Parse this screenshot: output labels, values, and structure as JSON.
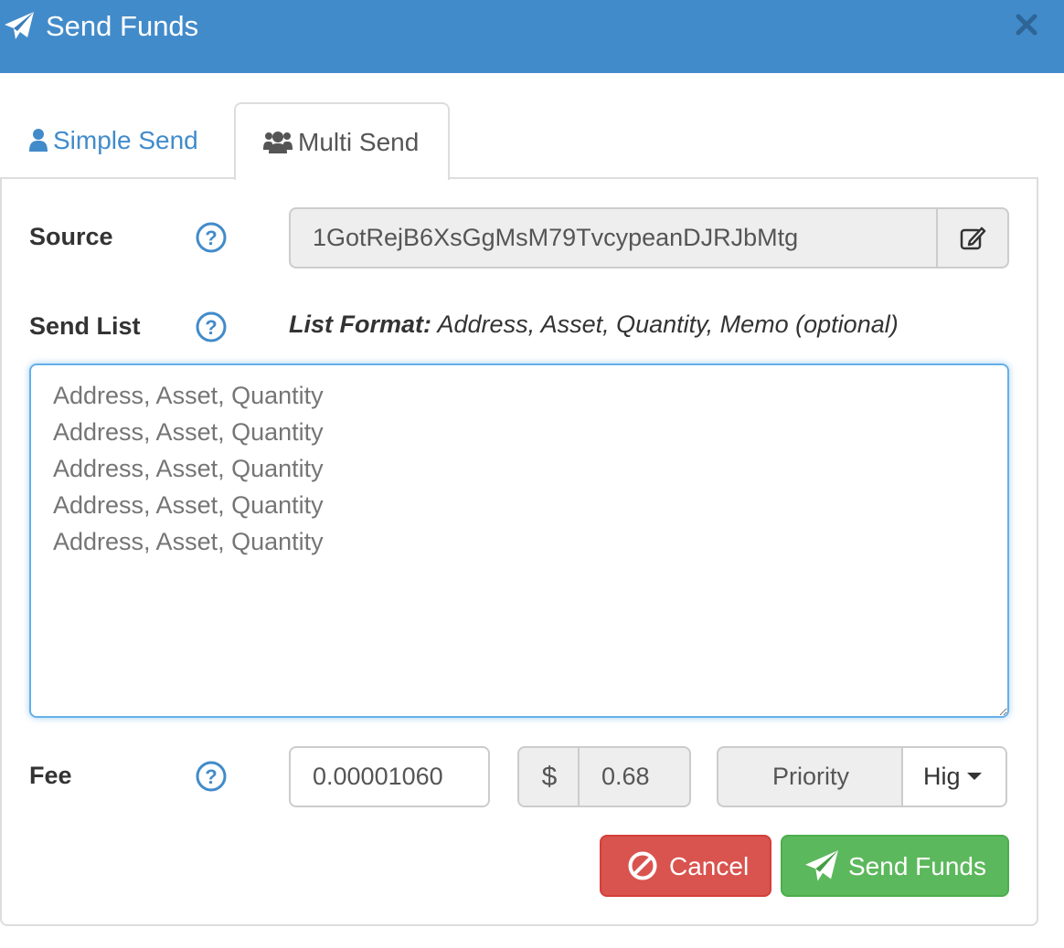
{
  "header": {
    "title": "Send Funds",
    "icon": "paper-plane-icon",
    "close_icon": "close-icon",
    "color": "#428bca"
  },
  "tabs": [
    {
      "label": "Simple Send",
      "icon": "user-icon",
      "active": false
    },
    {
      "label": "Multi Send",
      "icon": "users-icon",
      "active": true
    }
  ],
  "source": {
    "label": "Source",
    "value": "1GotRejB6XsGgMsM79TvcypeanDJRJbMtg",
    "edit_icon": "edit-icon"
  },
  "send_list": {
    "label": "Send List",
    "format_label": "List Format:",
    "format_text": " Address, Asset, Quantity, Memo (optional)",
    "placeholder": "Address, Asset, Quantity\nAddress, Asset, Quantity\nAddress, Asset, Quantity\nAddress, Asset, Quantity\nAddress, Asset, Quantity"
  },
  "fee": {
    "label": "Fee",
    "value": "0.00001060",
    "currency_symbol": "$",
    "usd_value": "0.68",
    "priority_label": "Priority",
    "priority_selected": "Hig"
  },
  "buttons": {
    "cancel": "Cancel",
    "send": "Send Funds",
    "cancel_color": "#d9534f",
    "send_color": "#5cb85c"
  }
}
